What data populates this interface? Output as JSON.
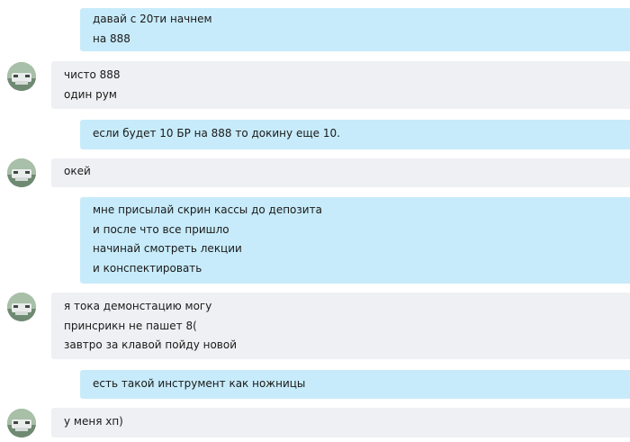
{
  "messages": [
    {
      "direction": "out",
      "lines": [
        "давай с 20ти начнем",
        "на 888"
      ]
    },
    {
      "direction": "in",
      "avatar": "contact-avatar",
      "lines": [
        "чисто 888",
        "один рум"
      ]
    },
    {
      "direction": "out",
      "lines": [
        "если будет 10 БР на 888 то докину еще 10."
      ]
    },
    {
      "direction": "in",
      "avatar": "contact-avatar",
      "lines": [
        "окей"
      ]
    },
    {
      "direction": "out",
      "lines": [
        "мне присылай скрин кассы до депозита",
        "и после что все пришло",
        "начинай смотреть лекции",
        "и конспектировать"
      ]
    },
    {
      "direction": "in",
      "avatar": "contact-avatar",
      "lines": [
        "я тока демонстацию могу",
        "принсрикн не пашет 8(",
        "завтро за клавой пойду новой"
      ]
    },
    {
      "direction": "out",
      "lines": [
        "есть такой инструмент как ножницы"
      ]
    },
    {
      "direction": "in",
      "avatar": "contact-avatar",
      "lines": [
        "у меня хп)"
      ]
    }
  ],
  "colors": {
    "outgoing_bubble": "#c7ebfa",
    "incoming_bubble": "#eff0f3",
    "background": "#ffffff",
    "text": "#1a1a1a"
  }
}
